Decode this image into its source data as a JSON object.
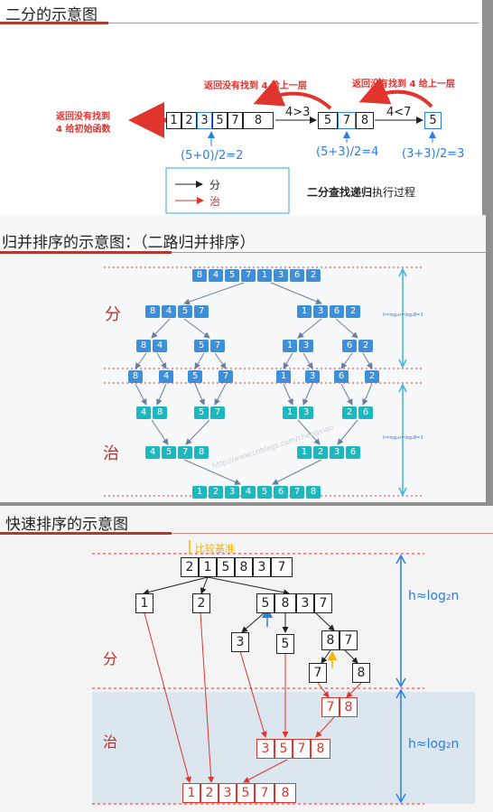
{
  "binary_search": {
    "title": "二分的示意图",
    "array": [
      "1",
      "2",
      "3",
      "5",
      "7",
      "8"
    ],
    "sub_array_1": [
      "5",
      "7",
      "8"
    ],
    "sub_array_2": [
      "5"
    ],
    "compare_1": "4>3",
    "compare_2": "4<7",
    "mid_1": "(5+0)/2=2",
    "mid_2": "(5+3)/2=4",
    "mid_3": "(3+3)/2=3",
    "return_up_1": "返回没有找到 4 给上一层",
    "return_up_2": "返回没有找到 4 给上一层",
    "return_initial_line1": "返回没有找到",
    "return_initial_line2": "4 给初始函数",
    "legend_divide": "分",
    "legend_conquer": "治",
    "caption_bold": "二分查找递归",
    "caption_rest": "执行过程",
    "colors": {
      "red": "#e0342e",
      "blue": "#2b7de1"
    }
  },
  "merge_sort": {
    "title": "归并排序的示意图：（二路归并排序）",
    "divide_label": "分",
    "conquer_label": "治",
    "height_formula": "h=log₂n=log₂8=3",
    "watermark": "http://www.cnblogs.com/chengxiao",
    "level0": [
      "8",
      "4",
      "5",
      "7",
      "1",
      "3",
      "6",
      "2"
    ],
    "level1": [
      [
        "8",
        "4",
        "5",
        "7"
      ],
      [
        "1",
        "3",
        "6",
        "2"
      ]
    ],
    "level2": [
      [
        "8",
        "4"
      ],
      [
        "5",
        "7"
      ],
      [
        "1",
        "3"
      ],
      [
        "6",
        "2"
      ]
    ],
    "level3": [
      "8",
      "4",
      "5",
      "7",
      "1",
      "3",
      "6",
      "2"
    ],
    "merged2": [
      [
        "4",
        "8"
      ],
      [
        "5",
        "7"
      ],
      [
        "1",
        "3"
      ],
      [
        "2",
        "6"
      ]
    ],
    "merged1": [
      [
        "4",
        "5",
        "7",
        "8"
      ],
      [
        "1",
        "2",
        "3",
        "6"
      ]
    ],
    "merged0": [
      "1",
      "2",
      "3",
      "4",
      "5",
      "6",
      "7",
      "8"
    ],
    "colors": {
      "blue": "#3c8fd8",
      "teal": "#1bb8c0",
      "arrow": "#6a7fa0"
    }
  },
  "quick_sort": {
    "title": "快速排序的示意图",
    "pivot_label": "比较基准",
    "initial": [
      "2",
      "1",
      "5",
      "8",
      "3",
      "7"
    ],
    "left_1": [
      "1"
    ],
    "left_2": [
      "2"
    ],
    "right_part": [
      "5",
      "8",
      "3",
      "7"
    ],
    "sub_3": [
      "3"
    ],
    "sub_5": [
      "5"
    ],
    "sub_87": [
      "8",
      "7"
    ],
    "leaf_7": [
      "7"
    ],
    "leaf_8": [
      "8"
    ],
    "merge_78": [
      "7",
      "8"
    ],
    "merge_3578": [
      "3",
      "5",
      "7",
      "8"
    ],
    "result": [
      "1",
      "2",
      "3",
      "5",
      "7",
      "8"
    ],
    "divide_label": "分",
    "conquer_label": "治",
    "height_top": "h≈log₂n",
    "height_bottom": "h≈log₂n",
    "colors": {
      "red": "#e0342e",
      "blue": "#2b7de1",
      "orange": "#f2b600"
    }
  }
}
